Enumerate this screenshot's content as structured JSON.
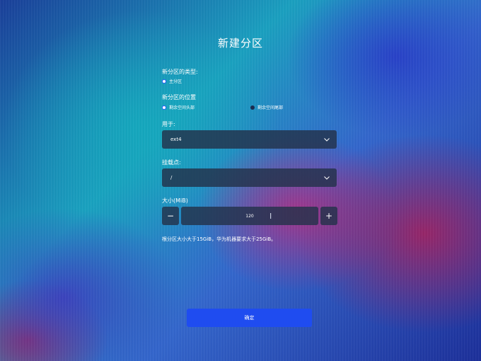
{
  "dialog": {
    "title": "新建分区",
    "type_section": {
      "label": "新分区的类型:",
      "option_primary": "主分区"
    },
    "location_section": {
      "label": "新分区的位置",
      "option_start": "剩余空间头部",
      "option_end": "剩余空间尾部",
      "selected": "剩余空间头部"
    },
    "filesystem": {
      "label": "用于:",
      "value": "ext4"
    },
    "mount_point": {
      "label": "挂载点:",
      "value": "/"
    },
    "size": {
      "label": "大小(MiB)",
      "value": "120",
      "decrement_symbol": "−",
      "increment_symbol": "+"
    },
    "hint": "根分区大小大于15GiB，华为机器要求大于25GiB。",
    "confirm_label": "确定"
  },
  "colors": {
    "accent": "#1f4cf0",
    "field_bg": "#23324b"
  }
}
